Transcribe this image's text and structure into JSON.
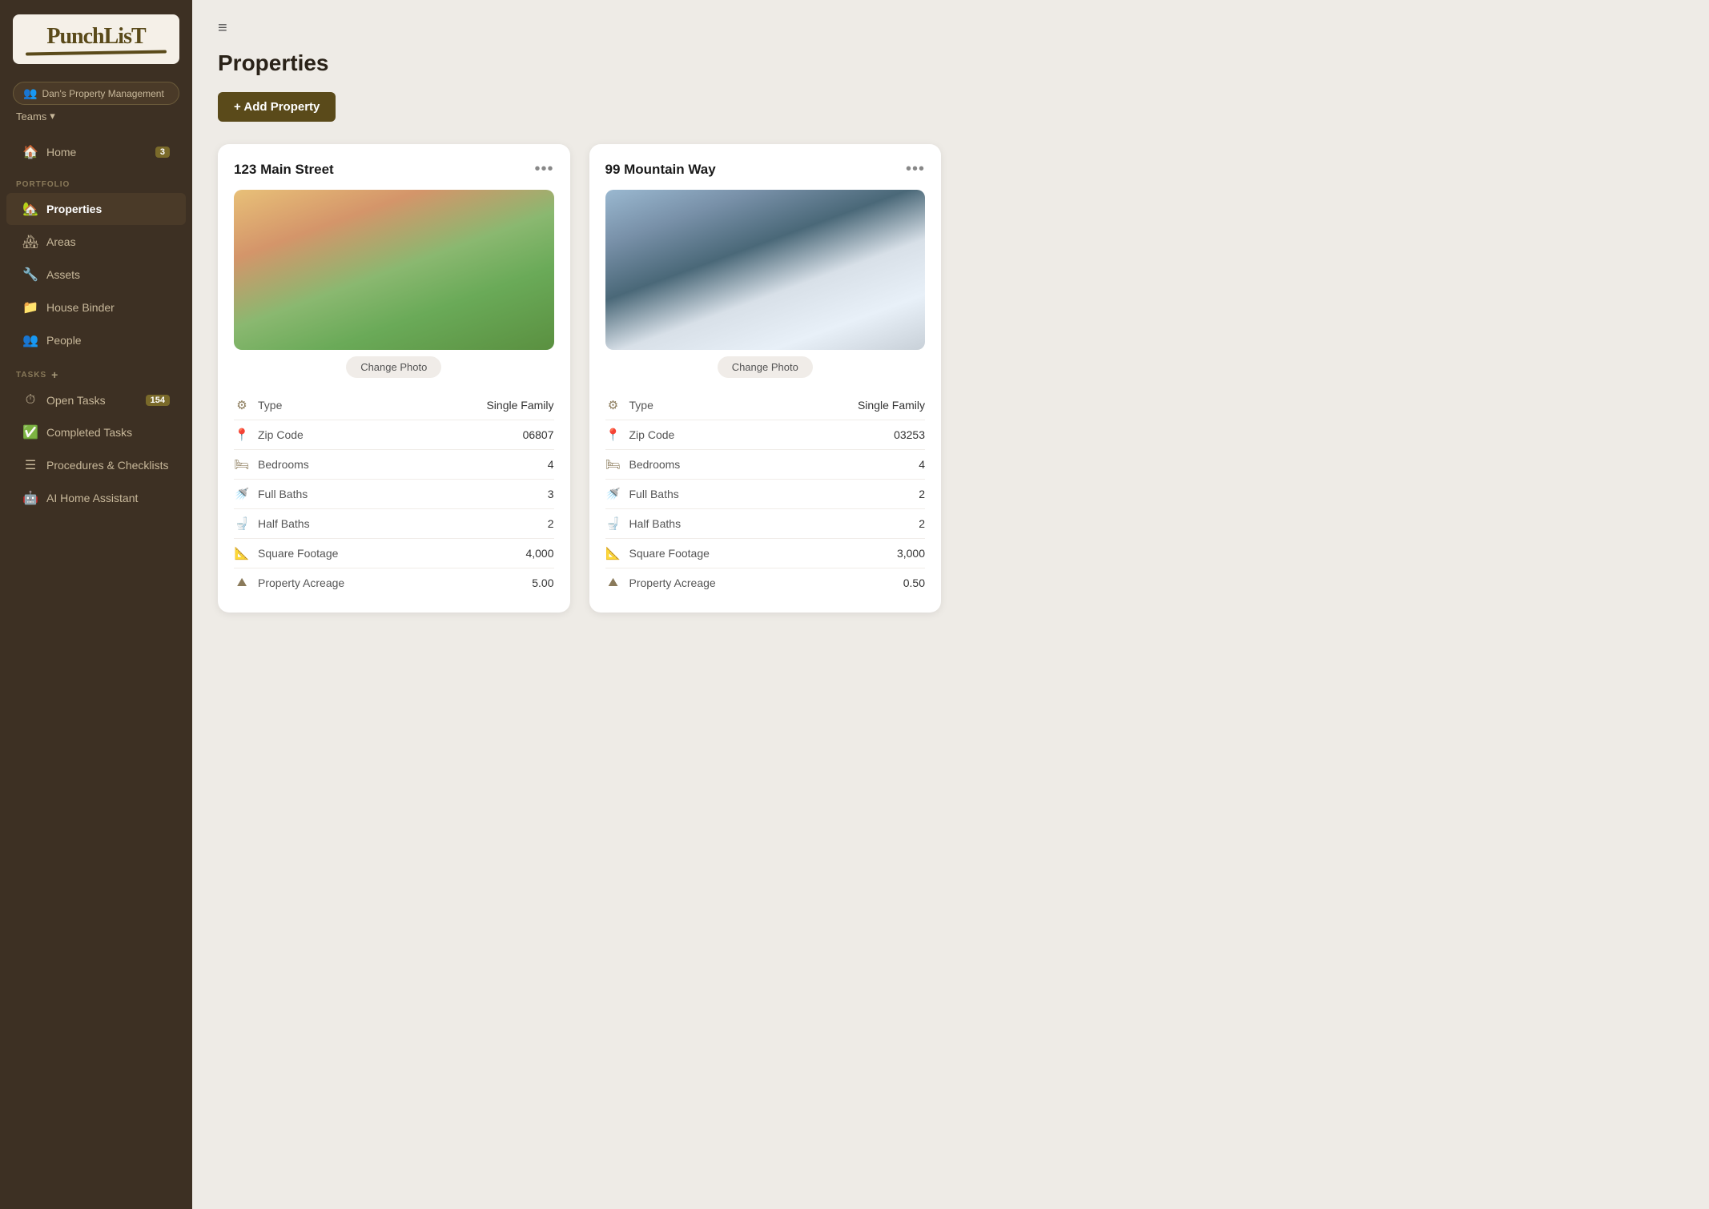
{
  "app": {
    "logo": "PunchLisT",
    "team_name": "Dan's Property Management",
    "teams_label": "Teams"
  },
  "sidebar": {
    "home_label": "Home",
    "home_badge": "3",
    "portfolio_label": "PORTFOLIO",
    "nav_items": [
      {
        "label": "Properties",
        "active": true,
        "icon": "🏠"
      },
      {
        "label": "Areas",
        "active": false,
        "icon": "🏘"
      },
      {
        "label": "Assets",
        "active": false,
        "icon": "🔧"
      },
      {
        "label": "House Binder",
        "active": false,
        "icon": "📁"
      },
      {
        "label": "People",
        "active": false,
        "icon": "👥"
      }
    ],
    "tasks_label": "TASKS",
    "task_items": [
      {
        "label": "Open Tasks",
        "active": false,
        "icon": "⏱",
        "badge": "154"
      },
      {
        "label": "Completed Tasks",
        "active": false,
        "icon": "✅"
      },
      {
        "label": "Procedures & Checklists",
        "active": false,
        "icon": "☰"
      },
      {
        "label": "AI Home Assistant",
        "active": false,
        "icon": "🤖"
      }
    ]
  },
  "main": {
    "hamburger": "≡",
    "page_title": "Properties",
    "add_button": "+ Add Property"
  },
  "properties": [
    {
      "id": "prop1",
      "address": "123 Main Street",
      "photo_style": "photo-1",
      "change_photo_label": "Change Photo",
      "details": [
        {
          "icon": "⚙",
          "label": "Type",
          "value": "Single Family"
        },
        {
          "icon": "📍",
          "label": "Zip Code",
          "value": "06807"
        },
        {
          "icon": "🛏",
          "label": "Bedrooms",
          "value": "4"
        },
        {
          "icon": "🚿",
          "label": "Full Baths",
          "value": "3"
        },
        {
          "icon": "🚽",
          "label": "Half Baths",
          "value": "2"
        },
        {
          "icon": "📐",
          "label": "Square Footage",
          "value": "4,000"
        },
        {
          "icon": "⛰",
          "label": "Property Acreage",
          "value": "5.00"
        }
      ]
    },
    {
      "id": "prop2",
      "address": "99 Mountain Way",
      "photo_style": "photo-2",
      "change_photo_label": "Change Photo",
      "details": [
        {
          "icon": "⚙",
          "label": "Type",
          "value": "Single Family"
        },
        {
          "icon": "📍",
          "label": "Zip Code",
          "value": "03253"
        },
        {
          "icon": "🛏",
          "label": "Bedrooms",
          "value": "4"
        },
        {
          "icon": "🚿",
          "label": "Full Baths",
          "value": "2"
        },
        {
          "icon": "🚽",
          "label": "Half Baths",
          "value": "2"
        },
        {
          "icon": "📐",
          "label": "Square Footage",
          "value": "3,000"
        },
        {
          "icon": "⛰",
          "label": "Property Acreage",
          "value": "0.50"
        }
      ]
    }
  ]
}
